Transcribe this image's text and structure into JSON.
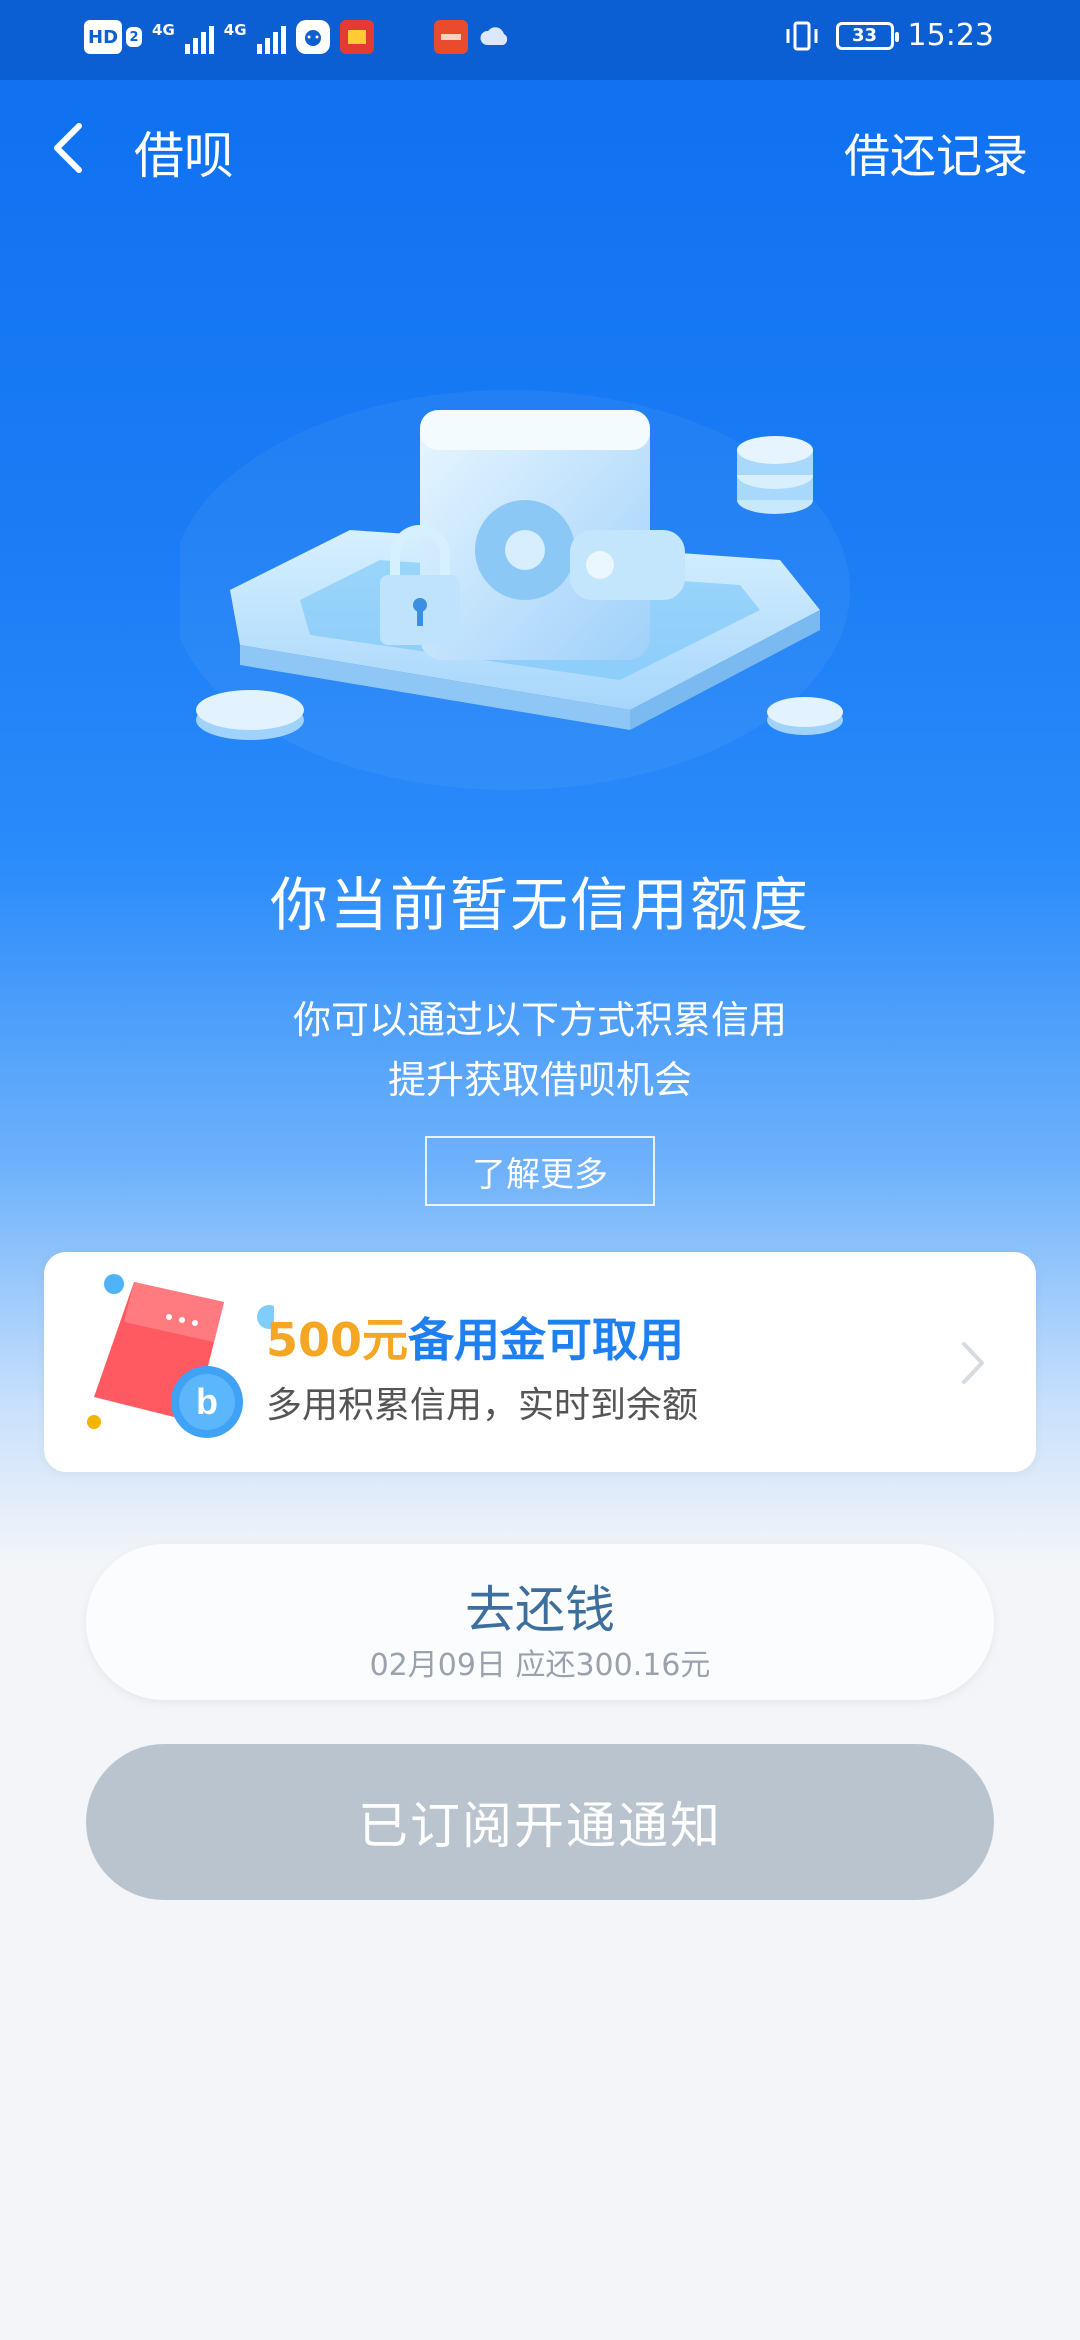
{
  "status_bar": {
    "hd_label": "HD",
    "hd_sub": "2",
    "net1": "4G",
    "net2": "4G",
    "time": "15:23",
    "battery": "33",
    "icons": [
      "hd-icon",
      "signal-icon",
      "signal-icon",
      "app-notification-icon",
      "app-notification-icon",
      "app-notification-icon",
      "cloud-icon",
      "vibrate-icon",
      "battery-icon"
    ]
  },
  "nav": {
    "title": "借呗",
    "right_link": "借还记录",
    "back_icon": "chevron-left-icon"
  },
  "hero": {
    "headline": "你当前暂无信用额度",
    "desc_line1": "你可以通过以下方式积累信用",
    "desc_line2": "提升获取借呗机会",
    "learn_more": "了解更多",
    "illustration_icon": "wallet-illustration-icon"
  },
  "promo": {
    "amount": "500元",
    "title_rest": "备用金可取用",
    "subtitle": "多用积累信用，实时到余额",
    "amount_color": "#f5a623",
    "title_color": "#1e7ff0"
  },
  "repay": {
    "label": "去还钱",
    "detail": "02月09日 应还300.16元"
  },
  "notify": {
    "label": "已订阅开通通知"
  },
  "colors": {
    "primary_blue": "#1a7df5",
    "status_bar": "#0c5fd3",
    "disabled_button": "#b9c4cf",
    "page_bg": "#f3f5f8"
  }
}
